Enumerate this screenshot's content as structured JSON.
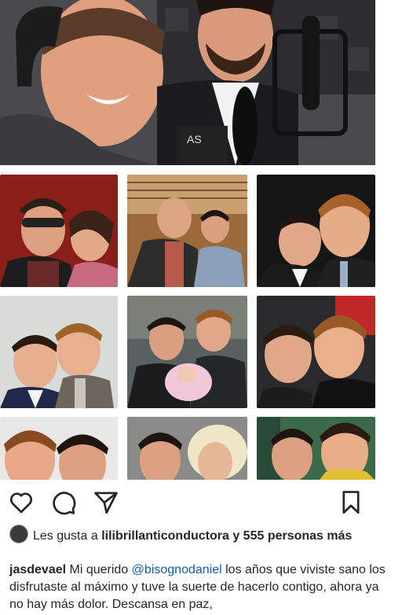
{
  "post": {
    "likes": {
      "prefix": "Les gusta a",
      "user": "lilibrillanticonductora",
      "suffix": "y 555 personas más"
    },
    "caption": {
      "author": "jasdevael",
      "text_before": "Mi querido",
      "mention": "@bisognodaniel",
      "text_after": "los años que viviste sano los disfrutaste al máximo y tuve la suerte de hacerlo contigo, ahora ya no hay más dolor. Descansa en paz,"
    },
    "cover_text": "AS"
  },
  "icons": [
    "heart-icon",
    "comment-icon",
    "share-icon",
    "bookmark-icon"
  ]
}
